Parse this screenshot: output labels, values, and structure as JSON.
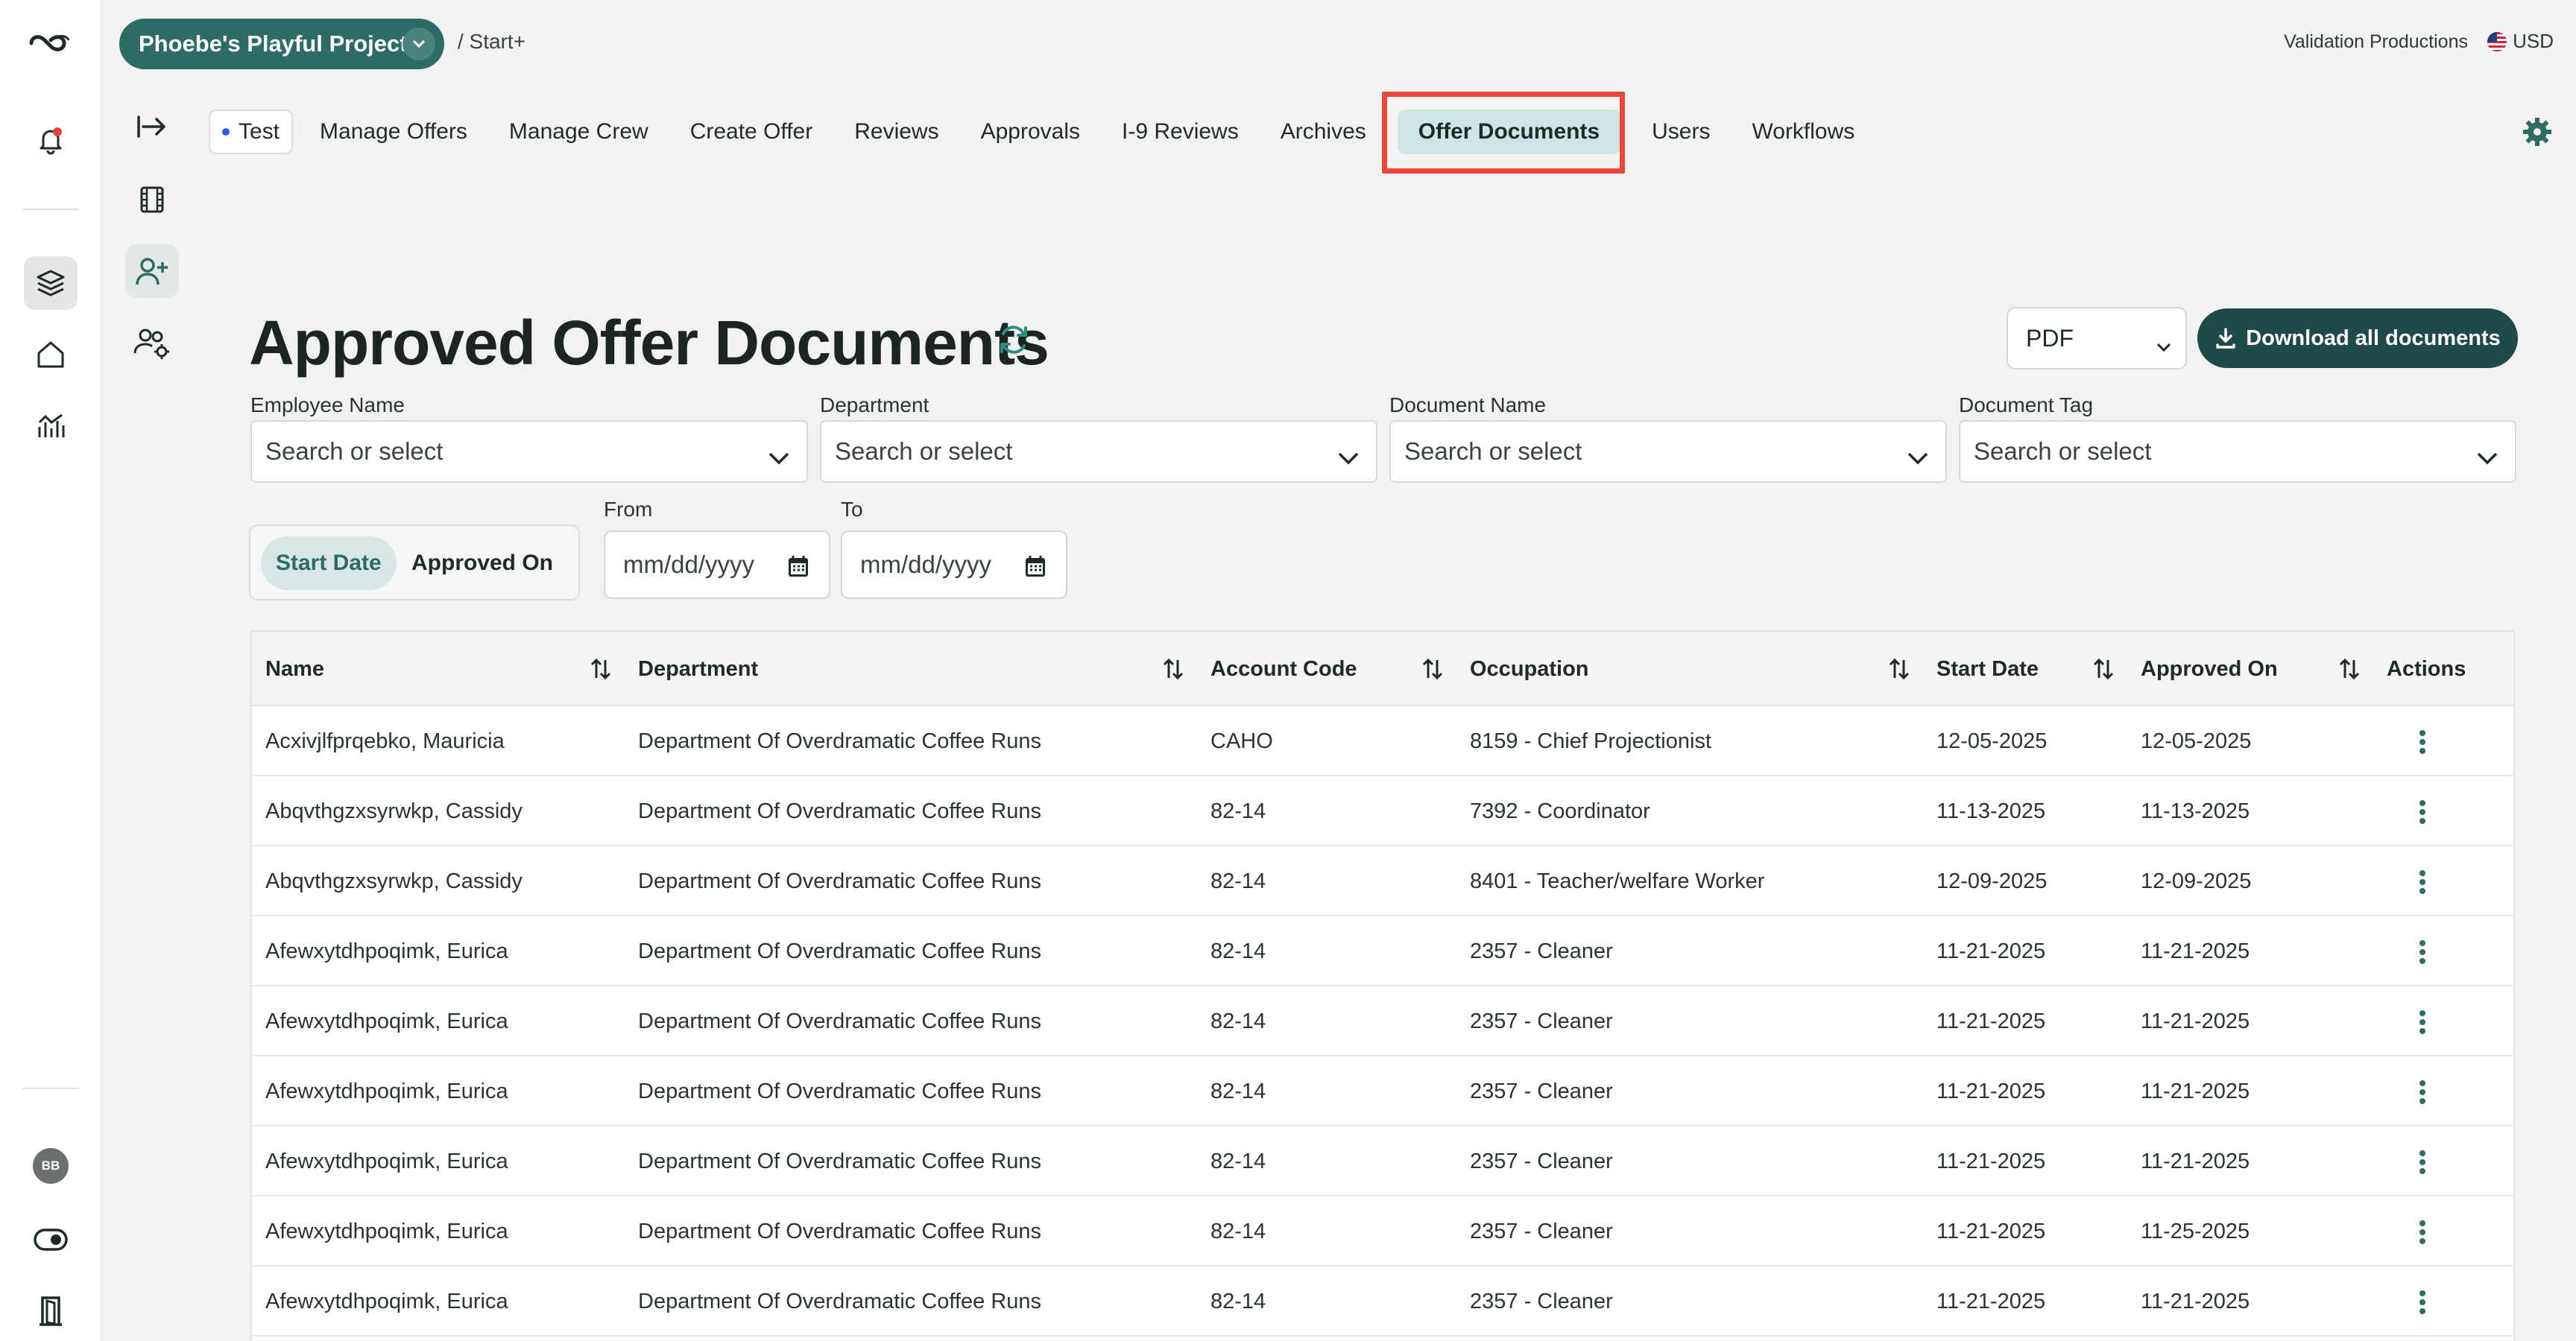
{
  "topbar": {
    "project_name": "Phoebe's Playful Project",
    "breadcrumb": "/ Start+",
    "company": "Validation Productions",
    "currency": "USD"
  },
  "rail": {
    "avatar_initials": "BB"
  },
  "tabs": [
    {
      "label": "Test"
    },
    {
      "label": "Manage Offers"
    },
    {
      "label": "Manage Crew"
    },
    {
      "label": "Create Offer"
    },
    {
      "label": "Reviews"
    },
    {
      "label": "Approvals"
    },
    {
      "label": "I-9 Reviews"
    },
    {
      "label": "Archives"
    },
    {
      "label": "Offer Documents"
    },
    {
      "label": "Users"
    },
    {
      "label": "Workflows"
    }
  ],
  "page": {
    "title": "Approved Offer Documents",
    "format_value": "PDF",
    "download_label": "Download all documents"
  },
  "filters": {
    "employee_label": "Employee Name",
    "employee_placeholder": "Search or select",
    "department_label": "Department",
    "department_placeholder": "Search or select",
    "document_label": "Document Name",
    "document_placeholder": "Search or select",
    "tag_label": "Document Tag",
    "tag_placeholder": "Search or select",
    "toggle_start": "Start Date",
    "toggle_approved": "Approved On",
    "from_label": "From",
    "from_placeholder": "mm/dd/yyyy",
    "to_label": "To",
    "to_placeholder": "mm/dd/yyyy"
  },
  "table": {
    "columns": [
      "Name",
      "Department",
      "Account Code",
      "Occupation",
      "Start Date",
      "Approved On",
      "Actions"
    ],
    "rows": [
      [
        "Acxivjlfprqebko, Mauricia",
        "Department Of Overdramatic Coffee Runs",
        "CAHO",
        "8159 - Chief Projectionist",
        "12-05-2025",
        "12-05-2025"
      ],
      [
        "Abqvthgzxsyrwkp, Cassidy",
        "Department Of Overdramatic Coffee Runs",
        "82-14",
        "7392 - Coordinator",
        "11-13-2025",
        "11-13-2025"
      ],
      [
        "Abqvthgzxsyrwkp, Cassidy",
        "Department Of Overdramatic Coffee Runs",
        "82-14",
        "8401 - Teacher/welfare Worker",
        "12-09-2025",
        "12-09-2025"
      ],
      [
        "Afewxytdhpoqimk, Eurica",
        "Department Of Overdramatic Coffee Runs",
        "82-14",
        "2357 - Cleaner",
        "11-21-2025",
        "11-21-2025"
      ],
      [
        "Afewxytdhpoqimk, Eurica",
        "Department Of Overdramatic Coffee Runs",
        "82-14",
        "2357 - Cleaner",
        "11-21-2025",
        "11-21-2025"
      ],
      [
        "Afewxytdhpoqimk, Eurica",
        "Department Of Overdramatic Coffee Runs",
        "82-14",
        "2357 - Cleaner",
        "11-21-2025",
        "11-21-2025"
      ],
      [
        "Afewxytdhpoqimk, Eurica",
        "Department Of Overdramatic Coffee Runs",
        "82-14",
        "2357 - Cleaner",
        "11-21-2025",
        "11-21-2025"
      ],
      [
        "Afewxytdhpoqimk, Eurica",
        "Department Of Overdramatic Coffee Runs",
        "82-14",
        "2357 - Cleaner",
        "11-21-2025",
        "11-25-2025"
      ],
      [
        "Afewxytdhpoqimk, Eurica",
        "Department Of Overdramatic Coffee Runs",
        "82-14",
        "2357 - Cleaner",
        "11-21-2025",
        "11-21-2025"
      ]
    ]
  },
  "colors": {
    "accent": "#2f6b65",
    "primary_button": "#1f4a48",
    "active_tab": "#cfe4e5",
    "highlight_box": "#e8483a"
  }
}
